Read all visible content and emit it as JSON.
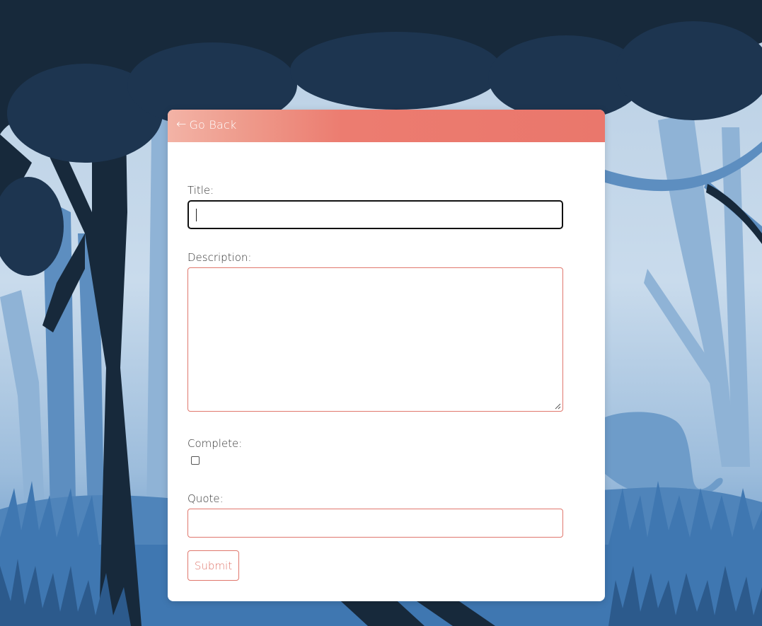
{
  "header": {
    "back_icon": "left-arrow-icon",
    "back_glyph": "←",
    "back_label": "Go Back"
  },
  "form": {
    "title_label": "Title:",
    "title_value": "",
    "description_label": "Description:",
    "description_value": "",
    "complete_label": "Complete:",
    "complete_checked": false,
    "quote_label": "Quote:",
    "quote_value": "",
    "submit_label": "Submit"
  },
  "colors": {
    "accent": "#ea776c",
    "header_gradient_start": "#f3b3a6",
    "card_background": "#ffffff",
    "forest_dark": "#17293b",
    "forest_mid": "#3b6e9e",
    "forest_light": "#7ea6cf"
  }
}
